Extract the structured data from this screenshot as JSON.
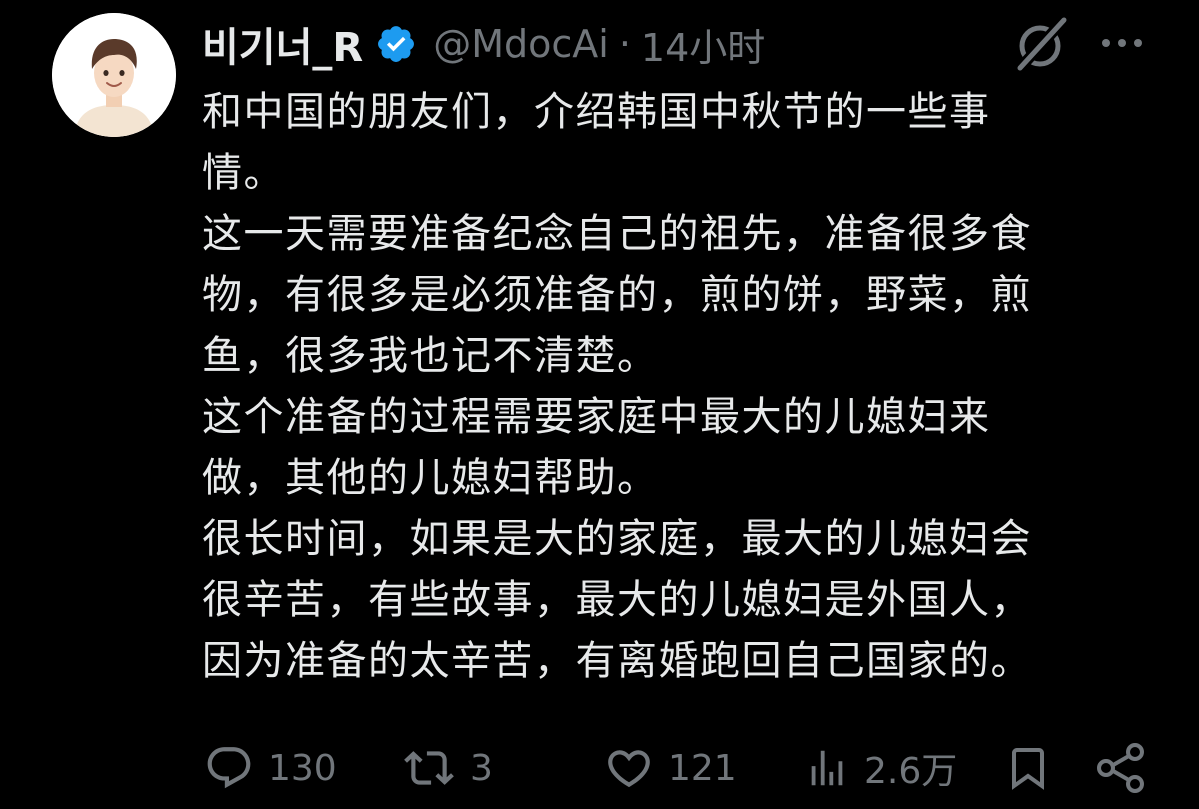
{
  "author": {
    "display_name": "비기너_R",
    "handle": "@MdocAi",
    "separator": "·",
    "timestamp": "14小时",
    "verified": true
  },
  "tweet": {
    "lines": [
      "和中国的朋友们，介绍韩国中秋节的一些事",
      "情。",
      "这一天需要准备纪念自己的祖先，准备很多食",
      "物，有很多是必须准备的，煎的饼，野菜，煎",
      "鱼，很多我也记不清楚。",
      "这个准备的过程需要家庭中最大的儿媳妇来",
      "做，其他的儿媳妇帮助。",
      "很长时间，如果是大的家庭，最大的儿媳妇会",
      "很辛苦，有些故事，最大的儿媳妇是外国人，",
      "因为准备的太辛苦，有离婚跑回自己国家的。"
    ]
  },
  "actions": {
    "reply_count": "130",
    "retweet_count": "3",
    "like_count": "121",
    "view_count": "2.6万"
  },
  "icons": {
    "avatar": "avatar-cartoon-person",
    "verified": "verified-badge-icon",
    "grok": "grok-icon",
    "more": "more-icon",
    "reply": "reply-icon",
    "retweet": "retweet-icon",
    "like": "like-icon",
    "views": "views-icon",
    "bookmark": "bookmark-icon",
    "share": "share-icon"
  },
  "colors": {
    "background": "#000000",
    "text_primary": "#e7e9ea",
    "text_secondary": "#71767b",
    "verified_blue": "#1d9bf0"
  }
}
